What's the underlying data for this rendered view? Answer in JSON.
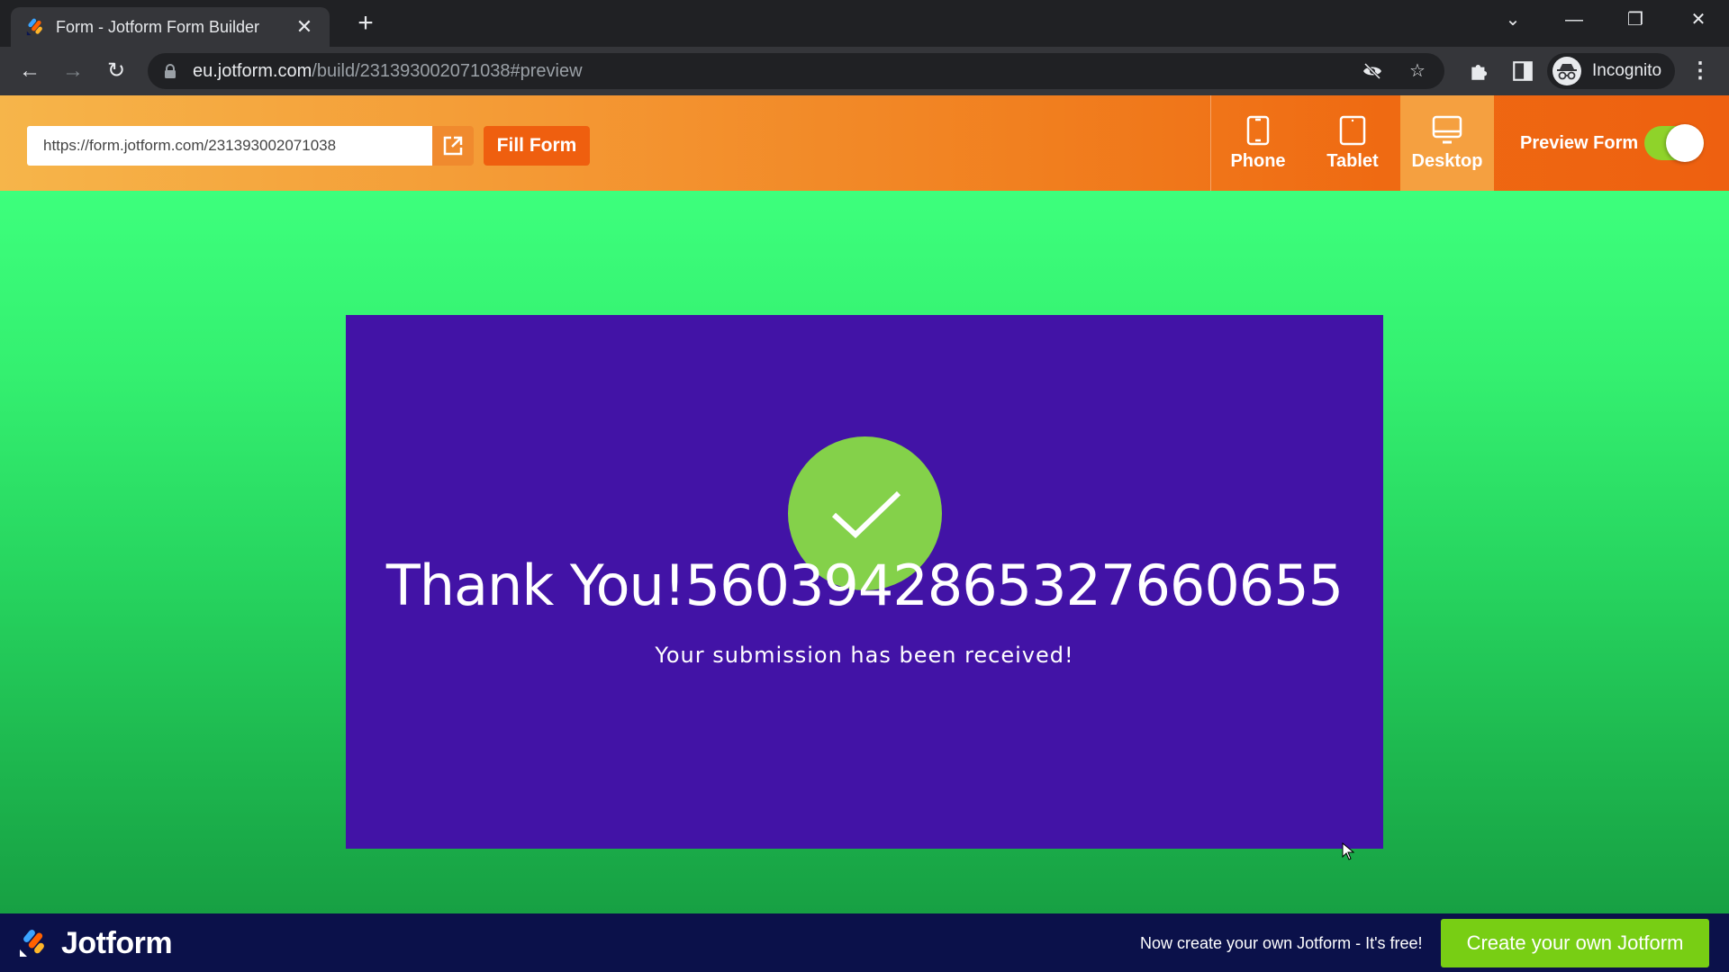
{
  "browser": {
    "tab_title": "Form - Jotform Form Builder",
    "url_domain": "eu.jotform.com",
    "url_path": "/build/231393002071038#preview",
    "profile_label": "Incognito"
  },
  "toolbar": {
    "form_url": "https://form.jotform.com/231393002071038",
    "fill_form_label": "Fill Form",
    "devices": [
      {
        "label": "Phone",
        "active": false
      },
      {
        "label": "Tablet",
        "active": false
      },
      {
        "label": "Desktop",
        "active": true
      }
    ],
    "preview_form_label": "Preview Form",
    "preview_toggle_on": true
  },
  "thankyou": {
    "title": "Thank You!5603942865327660655",
    "subtitle": "Your submission has been received!"
  },
  "footer": {
    "brand": "Jotform",
    "promo": "Now create your own Jotform - It's free!",
    "cta_label": "Create your own Jotform"
  },
  "colors": {
    "card_bg": "#4213a6",
    "check_bg": "#84d14a",
    "footer_bg": "#0b114a",
    "cta_bg": "#78ce14",
    "fill_btn_bg": "#ef5f0f"
  }
}
